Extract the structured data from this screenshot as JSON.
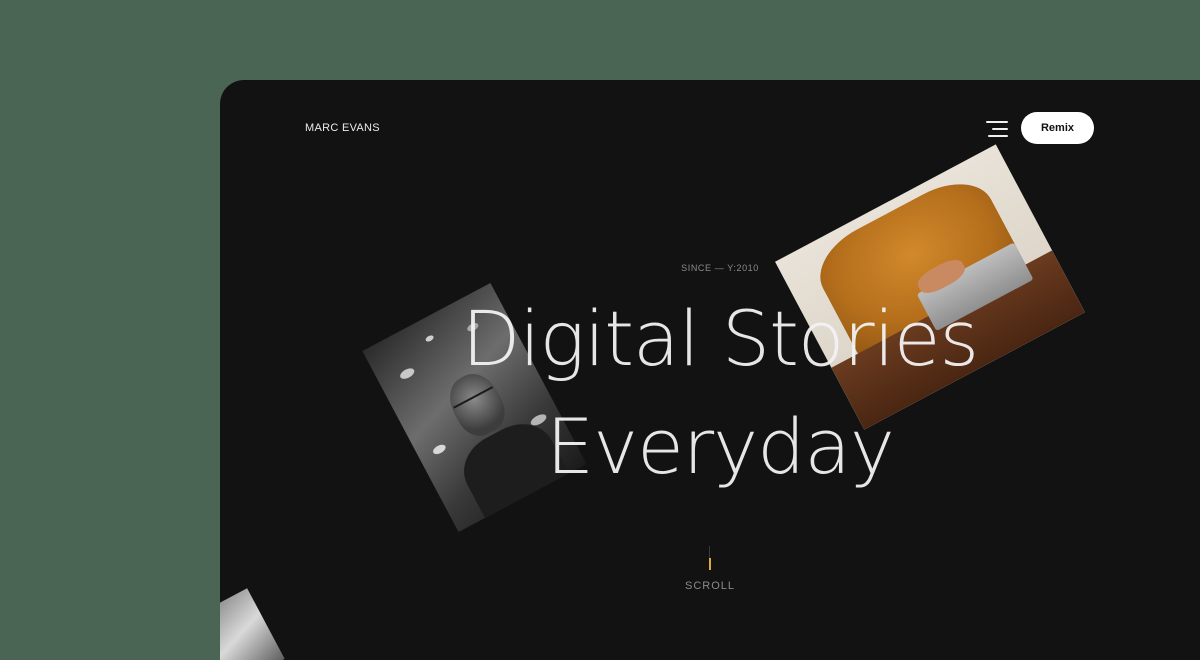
{
  "header": {
    "brand": "MARC EVANS",
    "menu_icon": "hamburger-menu-icon",
    "remix_label": "Remix"
  },
  "hero": {
    "since": "SINCE — Y:2010",
    "headline_line1": "Digital Stories",
    "headline_line2": "Everyday"
  },
  "scroll": {
    "label": "SCROLL",
    "indicator_color": "#e0a83a"
  },
  "colors": {
    "background": "#4a6553",
    "frame": "#121212",
    "button": "#ffffff"
  }
}
